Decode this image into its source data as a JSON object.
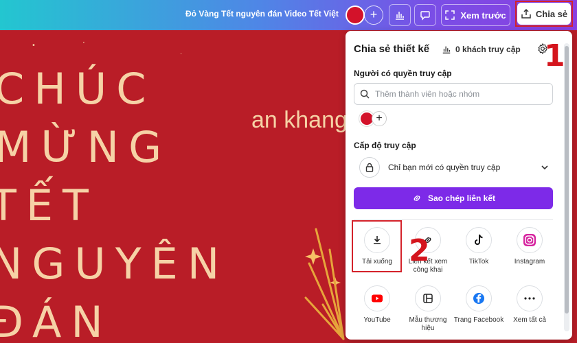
{
  "topbar": {
    "doc_title": "Đỏ Vàng Tết nguyên đán Video Tết Việt",
    "plus_label": "+",
    "preview_label": "Xem trước",
    "share_label": "Chia sẻ",
    "icons": [
      "stats-icon",
      "comment-icon",
      "expand-icon",
      "upload-icon"
    ]
  },
  "canvas": {
    "lines": [
      "CHÚC",
      "MỪNG",
      "TẾT",
      "NGUYÊN",
      "ĐÁN"
    ],
    "subtitle": "an khang"
  },
  "share_panel": {
    "title": "Chia sẻ thiết kế",
    "visitors": "0 khách truy cập",
    "access_people_label": "Người có quyền truy cập",
    "search_placeholder": "Thêm thành viên hoặc nhóm",
    "access_level_label": "Cấp độ truy cập",
    "access_value": "Chỉ bạn mới có quyền truy cập",
    "copy_link_label": "Sao chép liên kết",
    "options": [
      {
        "label": "Tải xuống",
        "icon": "download-icon"
      },
      {
        "label": "Liên kết xem công khai",
        "icon": "link-icon"
      },
      {
        "label": "TikTok",
        "icon": "tiktok-icon"
      },
      {
        "label": "Instagram",
        "icon": "instagram-icon"
      },
      {
        "label": "YouTube",
        "icon": "youtube-icon"
      },
      {
        "label": "Mẫu thương hiệu",
        "icon": "brand-template-icon"
      },
      {
        "label": "Trang Facebook",
        "icon": "facebook-icon"
      },
      {
        "label": "Xem tất cả",
        "icon": "more-icon"
      }
    ]
  },
  "annotations": {
    "step1": "1",
    "step2": "2"
  },
  "colors": {
    "accent": "#7d2ae8",
    "canvas_red": "#b91d27",
    "canvas_text": "#f6d2a6",
    "annotation_red": "#d4151d"
  }
}
